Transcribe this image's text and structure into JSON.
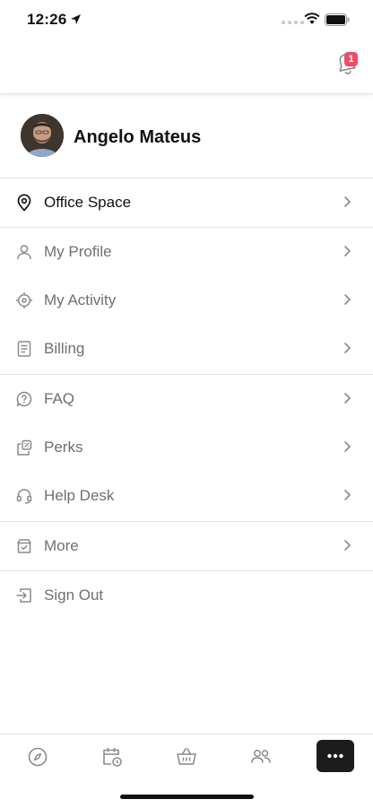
{
  "status_bar": {
    "time": "12:26"
  },
  "header": {
    "notification_count": "1"
  },
  "profile": {
    "name": "Angelo Mateus"
  },
  "menu": {
    "office_space": "Office Space",
    "my_profile": "My Profile",
    "my_activity": "My Activity",
    "billing": "Billing",
    "faq": "FAQ",
    "perks": "Perks",
    "help_desk": "Help Desk",
    "more": "More",
    "sign_out": "Sign Out"
  },
  "icons": {
    "office_space": "location-pin-icon",
    "my_profile": "user-icon",
    "my_activity": "crosshair-icon",
    "billing": "document-icon",
    "faq": "question-bubble-icon",
    "perks": "coupon-icon",
    "help_desk": "headset-icon",
    "more": "box-check-icon",
    "sign_out": "sign-out-icon"
  },
  "tab_bar": {
    "tabs": [
      "compass-icon",
      "calendar-clock-icon",
      "basket-icon",
      "people-icon",
      "more-dots-icon"
    ],
    "active": "more-dots-icon"
  },
  "colors": {
    "badge": "#ec4d68",
    "active_tab_bg": "#1c1c1c",
    "muted_text": "#6f6f6f",
    "primary_text": "#111111"
  }
}
